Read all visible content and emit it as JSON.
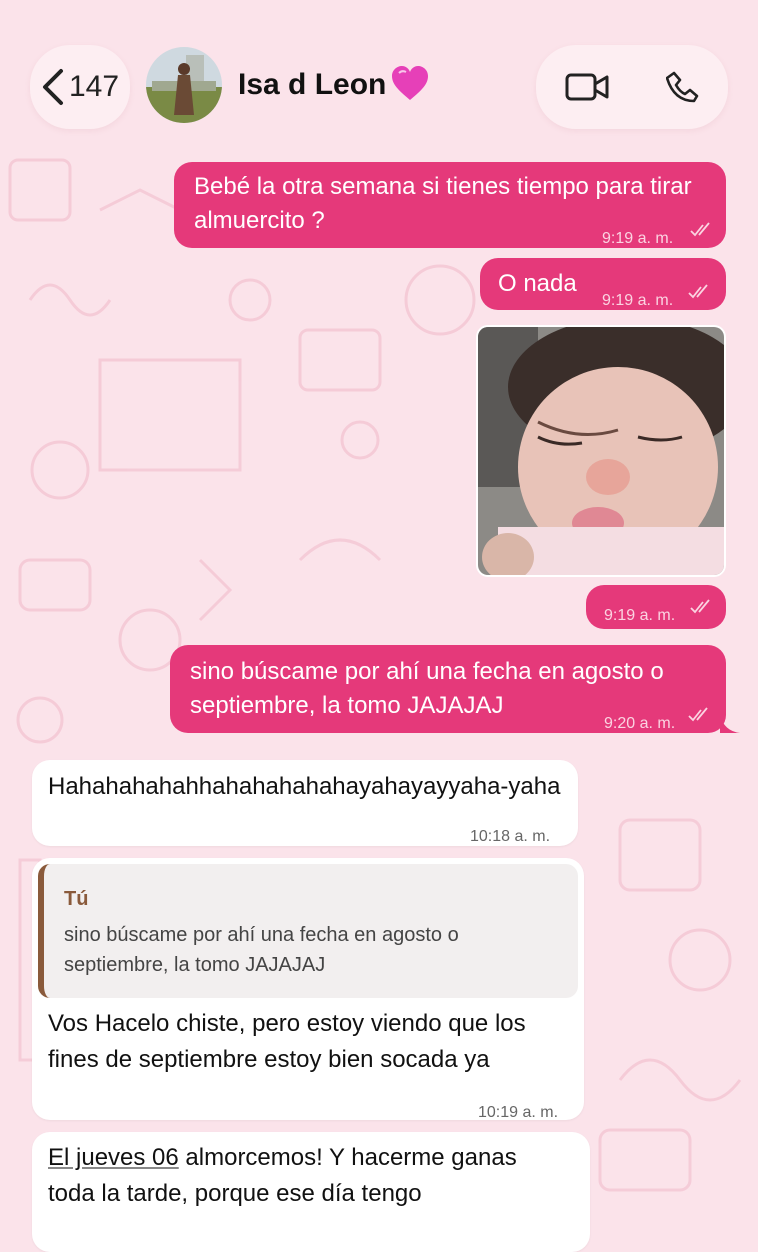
{
  "header": {
    "unread_count": "147",
    "contact_name": "Isa d Leon",
    "contact_emoji": "💗"
  },
  "messages": [
    {
      "type": "outgoing",
      "text": "Bebé la otra semana si tienes tiempo para tirar almuercito ?",
      "time": "9:19 a. m."
    },
    {
      "type": "outgoing",
      "text": "O nada",
      "time": "9:19 a. m."
    },
    {
      "type": "outgoing-image",
      "caption": "",
      "time": "9:19 a. m."
    },
    {
      "type": "outgoing",
      "text": "sino búscame por ahí una fecha en agosto o septiembre, la tomo JAJAJAJ",
      "time": "9:20 a. m."
    },
    {
      "type": "incoming",
      "text": "Hahahahahahhahahahahahayahayayyaha-yaha",
      "time": "10:18 a. m."
    },
    {
      "type": "incoming-reply",
      "quote_author": "Tú",
      "quote_text": "sino búscame por ahí una fecha en agosto o septiembre, la tomo JAJAJAJ",
      "text": "Vos Hacelo chiste, pero estoy viendo que los fines de septiembre estoy bien socada ya",
      "time": "10:19 a. m."
    },
    {
      "type": "incoming",
      "text_link": "El jueves 06",
      "text_rest": " almorcemos! Y hacerme ganas toda la tarde, porque ese día tengo"
    }
  ],
  "colors": {
    "outgoing_bubble": "#e5397a",
    "incoming_bubble": "#ffffff",
    "background": "#fbe3ea",
    "quote_accent": "#8a5a3b"
  },
  "icons": [
    "chevron-left-icon",
    "video-call-icon",
    "phone-call-icon",
    "double-check-icon"
  ]
}
